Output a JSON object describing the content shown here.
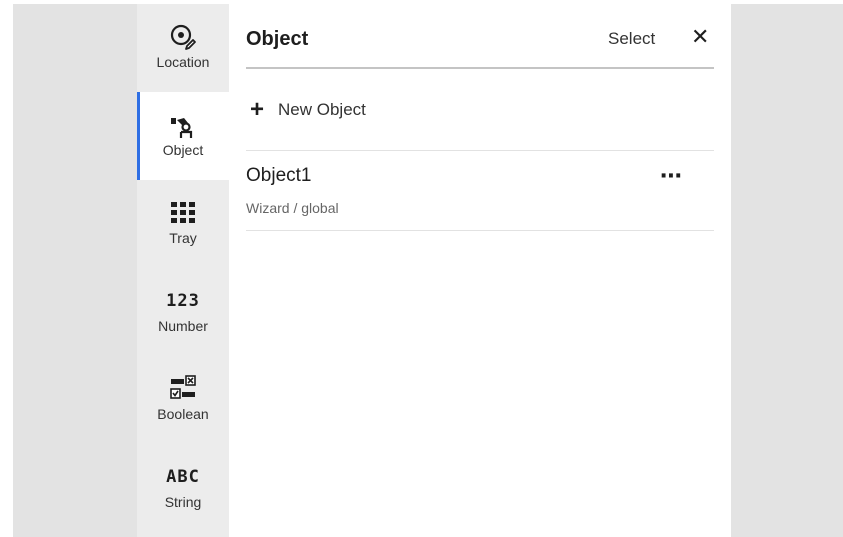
{
  "sidebar": {
    "items": [
      {
        "label": "Location",
        "icon": "location-pin-icon",
        "active": false
      },
      {
        "label": "Object",
        "icon": "robot-arm-icon",
        "active": true
      },
      {
        "label": "Tray",
        "icon": "grid-icon",
        "active": false
      },
      {
        "label": "Number",
        "icon": "number-icon",
        "icon_text": "123",
        "active": false
      },
      {
        "label": "Boolean",
        "icon": "boolean-toggle-icon",
        "active": false
      },
      {
        "label": "String",
        "icon": "string-icon",
        "icon_text": "ABC",
        "active": false
      }
    ]
  },
  "panel": {
    "title": "Object",
    "select_label": "Select",
    "close_glyph": "✕",
    "new_object_label": "New Object",
    "objects": [
      {
        "name": "Object1",
        "subtitle": "Wizard / global"
      }
    ]
  },
  "colors": {
    "accent": "#2f6fe4",
    "outer_background": "#e3e3e3",
    "sidebar_background": "#ececec"
  }
}
